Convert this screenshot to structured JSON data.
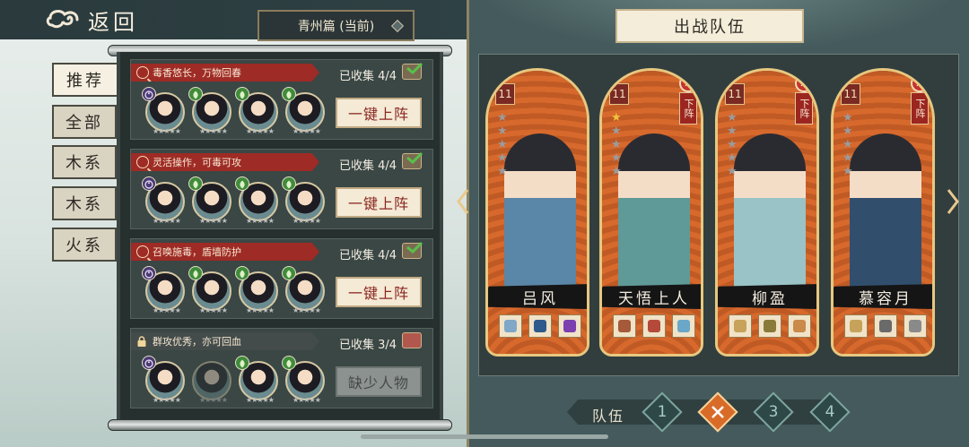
{
  "header": {
    "back_label": "返回",
    "chapter_label": "青州篇 (当前)"
  },
  "tabs": [
    {
      "label": "推荐",
      "active": true
    },
    {
      "label": "全部",
      "active": false
    },
    {
      "label": "木系",
      "active": false
    },
    {
      "label": "木系",
      "active": false
    },
    {
      "label": "火系",
      "active": false
    }
  ],
  "lineups": [
    {
      "description": "毒香悠长，万物回春",
      "collected": "已收集 4/4",
      "button": "一键上阵",
      "locked": false,
      "complete": true,
      "elements": [
        "yin",
        "wood",
        "wood",
        "wood"
      ]
    },
    {
      "description": "灵活操作，可毒可攻",
      "collected": "已收集 4/4",
      "button": "一键上阵",
      "locked": false,
      "complete": true,
      "elements": [
        "yin",
        "wood",
        "wood",
        "wood"
      ]
    },
    {
      "description": "召唤施毒，盾墙防护",
      "collected": "已收集 4/4",
      "button": "一键上阵",
      "locked": false,
      "complete": true,
      "elements": [
        "yin",
        "wood",
        "wood",
        "wood"
      ]
    },
    {
      "description": "群攻优秀，亦可回血",
      "collected": "已收集 3/4",
      "button": "缺少人物",
      "locked": true,
      "complete": false,
      "elements": [
        "yin",
        "none",
        "wood",
        "wood"
      ]
    }
  ],
  "team": {
    "title": "出战队伍",
    "heroes": [
      {
        "name": "吕风",
        "level": "11",
        "stars": 0,
        "removable": false,
        "remove_label": ""
      },
      {
        "name": "天悟上人",
        "level": "11",
        "stars": 1,
        "removable": true,
        "remove_label": "下阵"
      },
      {
        "name": "柳盈",
        "level": "11",
        "stars": 0,
        "removable": true,
        "remove_label": "下阵"
      },
      {
        "name": "慕容月",
        "level": "11",
        "stars": 0,
        "removable": true,
        "remove_label": "下阵"
      }
    ],
    "team_label": "队伍",
    "team_numbers": [
      "1",
      "2",
      "3",
      "4"
    ],
    "active_team": "2"
  },
  "colors": {
    "accent_red": "#9e2b25",
    "panel_dark": "#26302f",
    "hero_orange": "#c6541f",
    "team_active": "#d96b28"
  }
}
